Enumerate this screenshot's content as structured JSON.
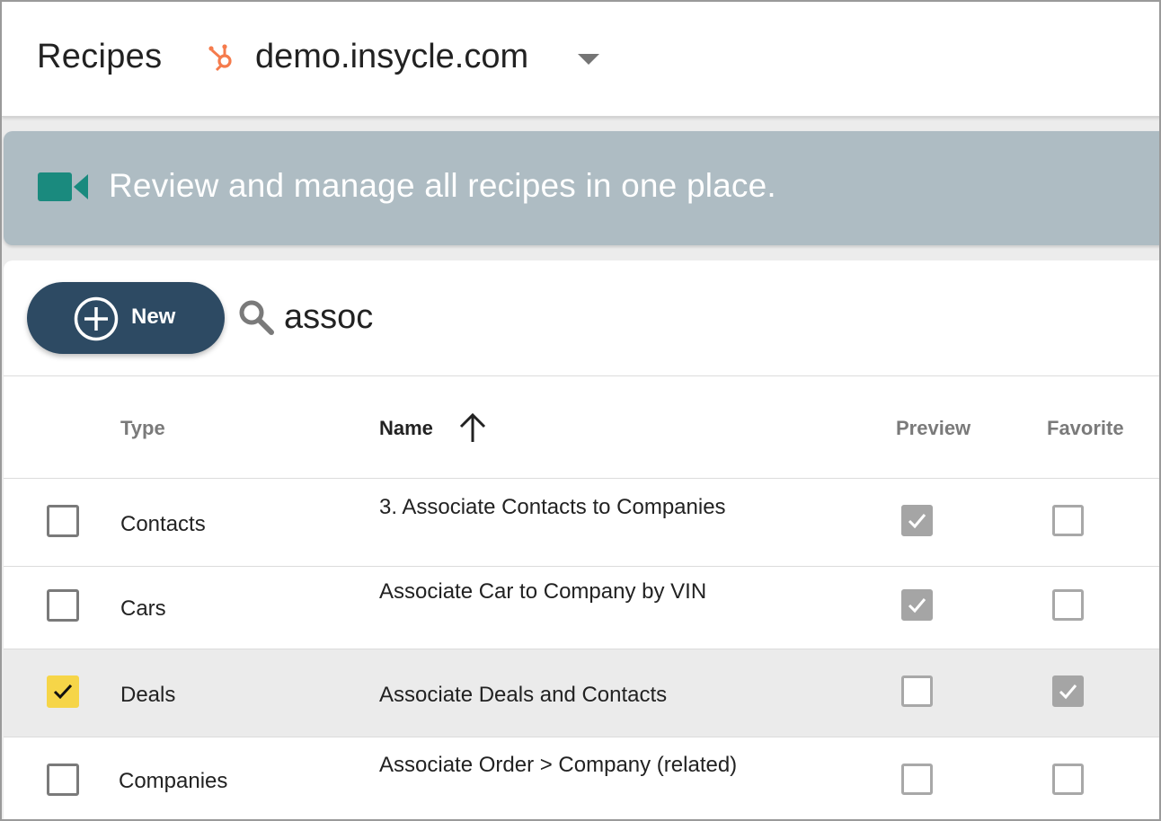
{
  "header": {
    "title": "Recipes",
    "portal": "demo.insycle.com",
    "portal_icon": "hubspot-sprocket-icon",
    "brand_color": "#f57b4c"
  },
  "banner": {
    "text": "Review and manage all recipes in one place.",
    "icon": "video-camera-icon",
    "icon_color": "#1a8a7e",
    "background": "#aebcc3"
  },
  "toolbar": {
    "new_label": "New",
    "search_value": "assoc",
    "search_placeholder": ""
  },
  "table": {
    "columns": {
      "type": "Type",
      "name": "Name",
      "preview": "Preview",
      "favorite": "Favorite"
    },
    "sort": {
      "column": "Name",
      "direction": "ascending"
    },
    "rows": [
      {
        "type": "Contacts",
        "name": "3. Associate Contacts to Companies",
        "selected": false,
        "preview": true,
        "favorite": false
      },
      {
        "type": "Cars",
        "name": "Associate Car to Company by VIN",
        "selected": false,
        "preview": true,
        "favorite": false
      },
      {
        "type": "Deals",
        "name": "Associate Deals and Contacts",
        "selected": true,
        "preview": false,
        "favorite": true
      },
      {
        "type": "Companies",
        "name": "Associate Order > Company (related)",
        "selected": false,
        "preview": false,
        "favorite": false
      }
    ]
  },
  "colors": {
    "button": "#2d4a63",
    "selected_checkbox": "#f6d548",
    "selected_row": "#ebebeb"
  }
}
